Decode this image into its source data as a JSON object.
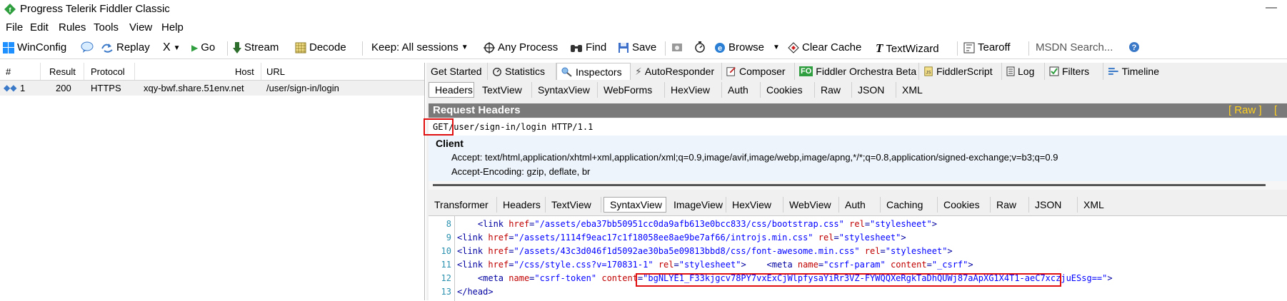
{
  "window": {
    "title": "Progress Telerik Fiddler Classic",
    "minimize_symbol": "—"
  },
  "menu": [
    "File",
    "Edit",
    "Rules",
    "Tools",
    "View",
    "Help"
  ],
  "toolbar": {
    "winconfig": "WinConfig",
    "replay": "Replay",
    "remove": "X",
    "go": "Go",
    "stream": "Stream",
    "decode": "Decode",
    "keep": "Keep: All sessions",
    "any_process": "Any Process",
    "find": "Find",
    "save": "Save",
    "browse": "Browse",
    "clear_cache": "Clear Cache",
    "textwizard": "TextWizard",
    "tearoff": "Tearoff",
    "msdn_placeholder": "MSDN Search..."
  },
  "sessions": {
    "columns": [
      "#",
      "Result",
      "Protocol",
      "Host",
      "URL"
    ],
    "rows": [
      {
        "num": "1",
        "result": "200",
        "protocol": "HTTPS",
        "host": "xqy-bwf.share.51env.net",
        "url": "/user/sign-in/login"
      }
    ]
  },
  "main_tabs": [
    {
      "label": "Get Started",
      "icon": ""
    },
    {
      "label": "Statistics",
      "icon": "stopwatch-icon"
    },
    {
      "label": "Inspectors",
      "icon": "inspector-icon"
    },
    {
      "label": "AutoResponder",
      "icon": "lightning-icon"
    },
    {
      "label": "Composer",
      "icon": "composer-icon"
    },
    {
      "label": "Fiddler Orchestra Beta",
      "icon": "fo-badge-icon"
    },
    {
      "label": "FiddlerScript",
      "icon": "script-icon"
    },
    {
      "label": "Log",
      "icon": "log-icon"
    },
    {
      "label": "Filters",
      "icon": "checkbox-icon"
    },
    {
      "label": "Timeline",
      "icon": "timeline-icon"
    }
  ],
  "fo_badge": "FO",
  "request_tabs": [
    "Headers",
    "TextView",
    "SyntaxView",
    "WebForms",
    "HexView",
    "Auth",
    "Cookies",
    "Raw",
    "JSON",
    "XML"
  ],
  "request_headers": {
    "title": "Request Headers",
    "raw_link": "[ Raw ]",
    "header_link": "[ H",
    "method": "GET",
    "request_line_rest": " /user/sign-in/login HTTP/1.1",
    "group": "Client",
    "accept": "Accept: text/html,application/xhtml+xml,application/xml;q=0.9,image/avif,image/webp,image/apng,*/*;q=0.8,application/signed-exchange;v=b3;q=0.9",
    "accept_encoding": "Accept-Encoding: gzip, deflate, br"
  },
  "response_tabs": [
    "Transformer",
    "Headers",
    "TextView",
    "SyntaxView",
    "ImageView",
    "HexView",
    "WebView",
    "Auth",
    "Caching",
    "Cookies",
    "Raw",
    "JSON",
    "XML"
  ],
  "code": {
    "lines": [
      {
        "n": "8",
        "indent": "    ",
        "parts": [
          [
            "tag",
            "<link "
          ],
          [
            "attr",
            "href"
          ],
          [
            "tag",
            "="
          ],
          [
            "val",
            "\"/assets/eba37bb50951cc0da9afb613e0bcc833/css/bootstrap.css\""
          ],
          [
            "tag",
            " "
          ],
          [
            "attr",
            "rel"
          ],
          [
            "tag",
            "="
          ],
          [
            "val",
            "\"stylesheet\""
          ],
          [
            "tag",
            ">"
          ]
        ]
      },
      {
        "n": "9",
        "indent": "",
        "parts": [
          [
            "tag",
            "<link "
          ],
          [
            "attr",
            "href"
          ],
          [
            "tag",
            "="
          ],
          [
            "val",
            "\"/assets/1114f9eac17c1f18058ee8ae9be7af66/introjs.min.css\""
          ],
          [
            "tag",
            " "
          ],
          [
            "attr",
            "rel"
          ],
          [
            "tag",
            "="
          ],
          [
            "val",
            "\"stylesheet\""
          ],
          [
            "tag",
            ">"
          ]
        ]
      },
      {
        "n": "10",
        "indent": "",
        "parts": [
          [
            "tag",
            "<link "
          ],
          [
            "attr",
            "href"
          ],
          [
            "tag",
            "="
          ],
          [
            "val",
            "\"/assets/43c3d046f1d5092ae30ba5e09813bbd8/css/font-awesome.min.css\""
          ],
          [
            "tag",
            " "
          ],
          [
            "attr",
            "rel"
          ],
          [
            "tag",
            "="
          ],
          [
            "val",
            "\"stylesheet\""
          ],
          [
            "tag",
            ">"
          ]
        ]
      },
      {
        "n": "11",
        "indent": "",
        "parts": [
          [
            "tag",
            "<link "
          ],
          [
            "attr",
            "href"
          ],
          [
            "tag",
            "="
          ],
          [
            "val",
            "\"/css/style.css?v=170831-1\""
          ],
          [
            "tag",
            " "
          ],
          [
            "attr",
            "rel"
          ],
          [
            "tag",
            "="
          ],
          [
            "val",
            "\"stylesheet\""
          ],
          [
            "tag",
            ">    <meta "
          ],
          [
            "attr",
            "name"
          ],
          [
            "tag",
            "="
          ],
          [
            "val",
            "\"csrf-param\""
          ],
          [
            "tag",
            " "
          ],
          [
            "attr",
            "content"
          ],
          [
            "tag",
            "="
          ],
          [
            "val",
            "\"_csrf\""
          ],
          [
            "tag",
            ">"
          ]
        ]
      },
      {
        "n": "12",
        "indent": "    ",
        "parts": [
          [
            "tag",
            "<meta "
          ],
          [
            "attr",
            "name"
          ],
          [
            "tag",
            "="
          ],
          [
            "val",
            "\"csrf-token\""
          ],
          [
            "tag",
            " "
          ],
          [
            "attr",
            "content"
          ],
          [
            "tag",
            "="
          ],
          [
            "val",
            "\"bgNLYE1_F33kjgcv78PY7vxExCjWlpfysaYiRr3VZ-FYWQQXeRgkTaDhQUWj87aApXG1X4T1-aeC7xczjuESsg==\""
          ],
          [
            "tag",
            ">"
          ]
        ]
      },
      {
        "n": "13",
        "indent": "",
        "parts": [
          [
            "tag",
            "</head>"
          ]
        ]
      }
    ]
  }
}
